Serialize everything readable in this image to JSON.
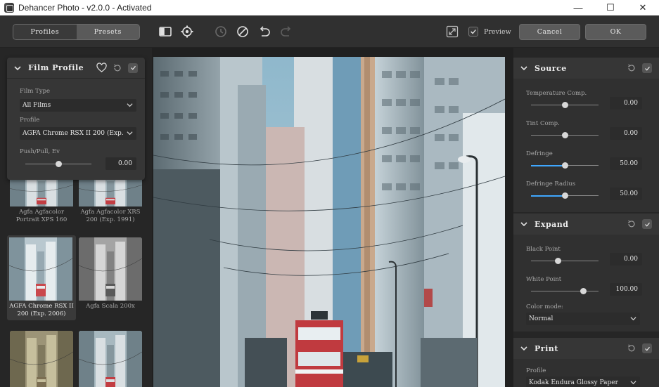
{
  "window": {
    "title": "Dehancer Photo - v2.0.0 - Activated",
    "controls": {
      "minimize": "—",
      "maximize": "☐",
      "close": "✕"
    }
  },
  "toolbar": {
    "tabs": [
      {
        "label": "Profiles",
        "active": true
      },
      {
        "label": "Presets",
        "active": false
      }
    ],
    "preview_label": "Preview",
    "preview_checked": true,
    "cancel_label": "Cancel",
    "ok_label": "OK"
  },
  "film_profile": {
    "title": "Film Profile",
    "film_type_label": "Film Type",
    "film_type_value": "All Films",
    "profile_label": "Profile",
    "profile_value": "AGFA Chrome RSX II 200 (Exp. 2006)",
    "push_pull_label": "Push/Pull, Ev",
    "push_pull_value": "0.00",
    "push_pull_level": 0.5
  },
  "thumbnails": [
    {
      "line1": "Agfa Agfacolor",
      "line2": "Portrait XPS 160",
      "tone": "color"
    },
    {
      "line1": "Agfa Agfacolor XRS",
      "line2": "200 (Exp. 1991)",
      "tone": "color"
    },
    {
      "line1": "AGFA Chrome RSX II",
      "line2": "200 (Exp. 2006)",
      "tone": "cool",
      "selected": true
    },
    {
      "line1": "Agfa Scala 200x",
      "line2": "",
      "tone": "bw"
    },
    {
      "line1": "",
      "line2": "",
      "tone": "sepia"
    },
    {
      "line1": "",
      "line2": "",
      "tone": "color"
    }
  ],
  "source": {
    "title": "Source",
    "params": [
      {
        "label": "Temperature Comp.",
        "value": "0.00",
        "level": 0.5,
        "fill": false
      },
      {
        "label": "Tint Comp.",
        "value": "0.00",
        "level": 0.5,
        "fill": false
      },
      {
        "label": "Defringe",
        "value": "50.00",
        "level": 0.5,
        "fill": true
      },
      {
        "label": "Defringe Radius",
        "value": "50.00",
        "level": 0.5,
        "fill": true
      }
    ]
  },
  "expand": {
    "title": "Expand",
    "params": [
      {
        "label": "Black Point",
        "value": "0.00",
        "level": 0.4,
        "fill": false
      },
      {
        "label": "White Point",
        "value": "100.00",
        "level": 0.78,
        "fill": false
      }
    ],
    "color_mode_label": "Color mode:",
    "color_mode_value": "Normal"
  },
  "print": {
    "title": "Print",
    "profile_label": "Profile",
    "profile_value": "Kodak Endura Glossy Paper"
  },
  "colors": {
    "accent": "#3fa7ff",
    "panel": "#363636",
    "background": "#262626"
  }
}
